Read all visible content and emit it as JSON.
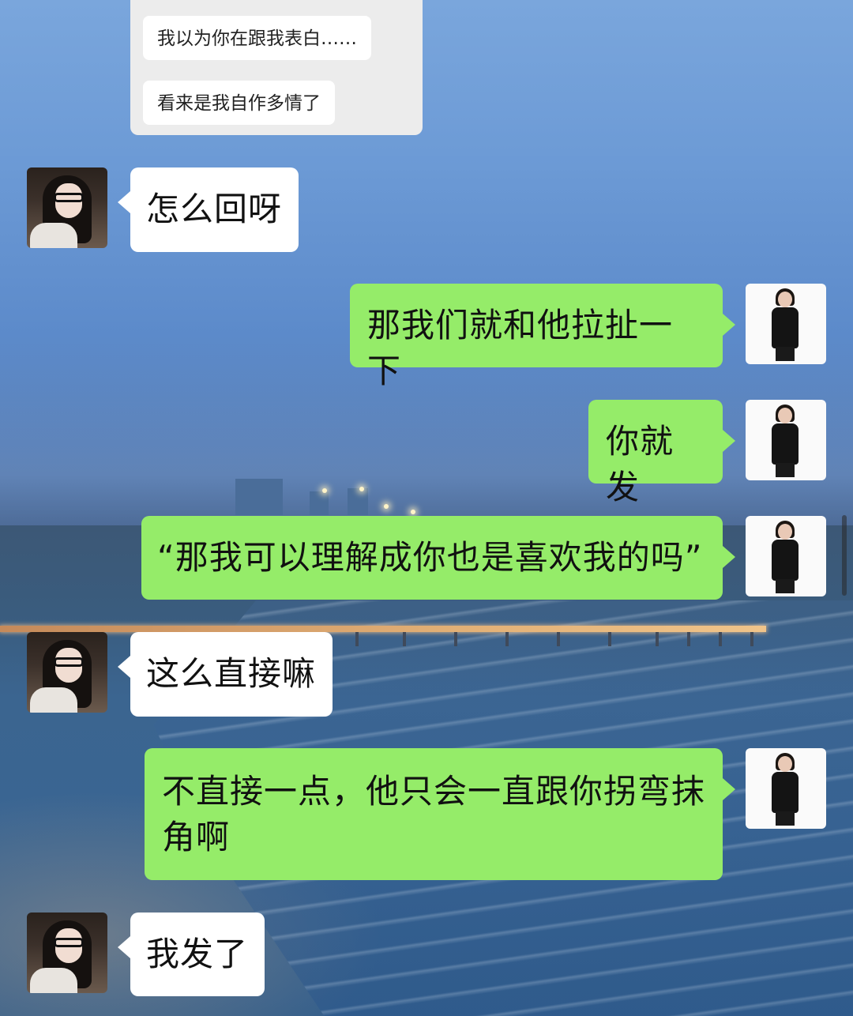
{
  "quoted": {
    "line1": "我以为你在跟我表白……",
    "line2": "看来是我自作多情了"
  },
  "messages": [
    {
      "side": "left",
      "text": "怎么回呀"
    },
    {
      "side": "right",
      "text": "那我们就和他拉扯一下"
    },
    {
      "side": "right",
      "text": "你就发"
    },
    {
      "side": "right",
      "text": "“那我可以理解成你也是喜欢我的吗”"
    },
    {
      "side": "left",
      "text": "这么直接嘛"
    },
    {
      "side": "right",
      "text": "不直接一点，他只会一直跟你拐弯抹角啊"
    },
    {
      "side": "left",
      "text": "我发了"
    }
  ],
  "colors": {
    "bubble_sent": "#95ec69",
    "bubble_received": "#ffffff"
  }
}
